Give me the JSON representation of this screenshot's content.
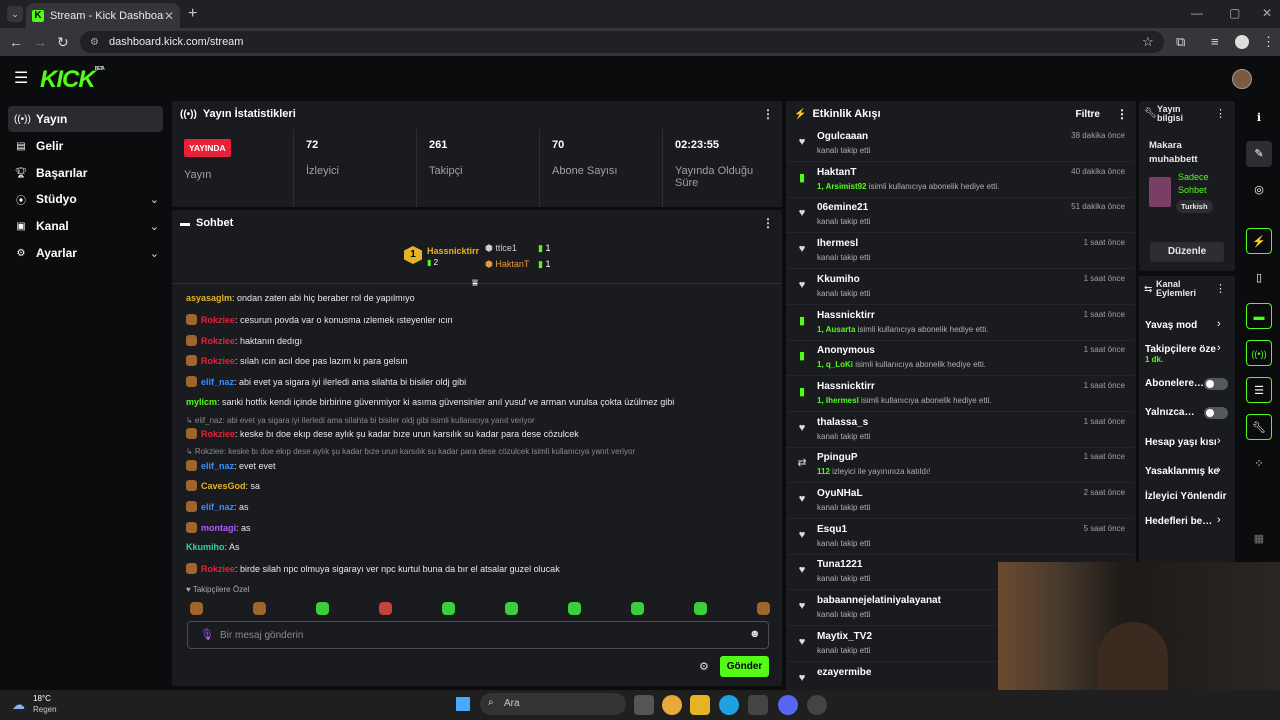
{
  "browser": {
    "tab_title": "Stream - Kick Dashboard",
    "url": "dashboard.kick.com/stream"
  },
  "brand": {
    "logo": "KICK",
    "logo_sup": "BETA",
    "accent": "#53fc18",
    "live_color": "#e8203a"
  },
  "sidebar": {
    "items": [
      {
        "label": "Yayın",
        "icon": "broadcast-icon",
        "active": true
      },
      {
        "label": "Gelir",
        "icon": "money-icon"
      },
      {
        "label": "Başarılar",
        "icon": "trophy-icon"
      },
      {
        "label": "Stüdyo",
        "icon": "studio-icon",
        "expand": true
      },
      {
        "label": "Kanal",
        "icon": "channel-icon",
        "expand": true
      },
      {
        "label": "Ayarlar",
        "icon": "gear-icon",
        "expand": true
      }
    ]
  },
  "stats": {
    "title": "Yayın İstatistikleri",
    "live_badge": "YAYINDA",
    "live_label": "Yayın",
    "items": [
      {
        "value": "72",
        "label": "İzleyici"
      },
      {
        "value": "261",
        "label": "Takipçi"
      },
      {
        "value": "70",
        "label": "Abone Sayısı"
      },
      {
        "value": "02:23:55",
        "label": "Yayında Olduğu Süre"
      }
    ]
  },
  "chat": {
    "title": "Sohbet",
    "top": {
      "rank": "1",
      "name": "Hassnicktirr",
      "count": "2",
      "second": {
        "name": "ttlce1",
        "count": "1"
      },
      "third": {
        "name": "HaktanT",
        "count": "1"
      }
    },
    "messages": [
      {
        "user": "asyasaglm",
        "color": "#e6b422",
        "text": ": ondan zaten abi hiç beraber rol de yapılmıyo",
        "badge": false
      },
      {
        "user": "Rokziee",
        "color": "#e8203a",
        "text": ": cesurun povda var o konusma ızlemek ısteyenler ıcın",
        "badge": true
      },
      {
        "user": "Rokziee",
        "color": "#e8203a",
        "text": ": haktanın dedıgı",
        "badge": true
      },
      {
        "user": "Rokziee",
        "color": "#e8203a",
        "text": ": sılah ıcın acıl doe pas lazım kı para gelsın",
        "badge": true
      },
      {
        "user": "elif_naz",
        "color": "#3b8dff",
        "text": ": abi evet ya sigara iyi ilerledi ama silahta bi bisiler oldj gibi",
        "badge": true
      },
      {
        "user": "mylicm",
        "color": "#53fc18",
        "text": ": sanki hotfix kendi içinde birbirine güvenmiyor ki asıma güvensinler anıl yusuf ve arman vurulsa çokta üzülmez gibi",
        "badge": false
      },
      {
        "reply": "↳ elif_naz: abi evet ya sigara iyi ilerledi ama silahta bi bisiler oldj gibi isimli kullanıcıya yanıt veriyor"
      },
      {
        "user": "Rokziee",
        "color": "#e8203a",
        "text": ": keske bı doe ekıp dese aylık şu kadar bıze urun karsılık su kadar para dese cözulcek",
        "badge": true
      },
      {
        "reply": "↳ Rokziee: keske bı doe ekıp dese aylık şu kadar bıze urun karsılık su kadar para dese cözulcek isimli kullanıcıya yanıt veriyor"
      },
      {
        "user": "elif_naz",
        "color": "#3b8dff",
        "text": ": evet evet",
        "badge": true
      },
      {
        "user": "CavesGod",
        "color": "#e6b422",
        "text": ": sa",
        "badge": true
      },
      {
        "user": "elif_naz",
        "color": "#3b8dff",
        "text": ": as",
        "badge": true
      },
      {
        "user": "montagi",
        "color": "#b05cff",
        "text": ": as",
        "badge": true
      },
      {
        "user": "Kkumiho",
        "color": "#2fd3a4",
        "text": ": As",
        "badge": false
      },
      {
        "user": "Rokziee",
        "color": "#e8203a",
        "text": ": birde silah npc olmuya sigarayı ver npc kurtul buna da bır el atsalar guzel olucak",
        "badge": true
      }
    ],
    "followers_only": "Takipçilere Özel",
    "input_placeholder": "Bir mesaj gönderin",
    "send_label": "Gönder"
  },
  "events": {
    "title": "Etkinlik Akışı",
    "filter_label": "Filtre",
    "items": [
      {
        "name": "Ogulcaaan",
        "desc": "kanalı takip etti",
        "time": "38 dakika önce",
        "type": "follow"
      },
      {
        "name": "HaktanT",
        "hl": "1, Arsimist92",
        "desc": " isimli kullanıcıya abonelik hediye etti.",
        "time": "40 dakika önce",
        "type": "gift"
      },
      {
        "name": "06emine21",
        "desc": "kanalı takip etti",
        "time": "51 dakika önce",
        "type": "follow"
      },
      {
        "name": "Ihermesl",
        "desc": "kanalı takip etti",
        "time": "1 saat önce",
        "type": "follow"
      },
      {
        "name": "Kkumiho",
        "desc": "kanalı takip etti",
        "time": "1 saat önce",
        "type": "follow"
      },
      {
        "name": "Hassnicktirr",
        "hl": "1, Ausarta",
        "desc": " isimli kullanıcıya abonelik hediye etti.",
        "time": "1 saat önce",
        "type": "gift"
      },
      {
        "name": "Anonymous",
        "hl": "1, q_LoKi",
        "desc": " isimli kullanıcıya abonelik hediye etti.",
        "time": "1 saat önce",
        "type": "gift"
      },
      {
        "name": "Hassnicktirr",
        "hl": "1, Ihermesl",
        "desc": " isimli kullanıcıya abonelik hediye etti.",
        "time": "1 saat önce",
        "type": "gift"
      },
      {
        "name": "thalassa_s",
        "desc": "kanalı takip etti",
        "time": "1 saat önce",
        "type": "follow"
      },
      {
        "name": "PpinguP",
        "hl": "112",
        "desc": " izleyici ile yayınınıza katıldı!",
        "time": "1 saat önce",
        "type": "host"
      },
      {
        "name": "OyuNHaL",
        "desc": "kanalı takip etti",
        "time": "2 saat önce",
        "type": "follow"
      },
      {
        "name": "Esqu1",
        "desc": "kanalı takip etti",
        "time": "5 saat önce",
        "type": "follow"
      },
      {
        "name": "Tuna1221",
        "desc": "kanalı takip etti",
        "time": "",
        "type": "follow"
      },
      {
        "name": "babaannejelatiniyalayanat",
        "desc": "kanalı takip etti",
        "time": "",
        "type": "follow"
      },
      {
        "name": "Maytix_TV2",
        "desc": "kanalı takip etti",
        "time": "",
        "type": "follow"
      },
      {
        "name": "ezayermibe",
        "desc": "",
        "time": "",
        "type": "follow"
      }
    ]
  },
  "stream_info": {
    "title": "Yayın bilgisi",
    "stream_title": "Makara muhabbett",
    "category": "Sadece Sohbet",
    "tag": "Turkish",
    "edit_label": "Düzenle"
  },
  "channel_actions": {
    "title": "Kanal Eylemleri",
    "items": [
      {
        "label": "Yavaş mod",
        "kind": "chevron"
      },
      {
        "label": "Takipçilere öze",
        "sub": "1 dk.",
        "kind": "chevron"
      },
      {
        "label": "Abonelere…",
        "kind": "toggle"
      },
      {
        "label": "Yalnızca…",
        "kind": "toggle"
      },
      {
        "label": "Hesap yaşı kısı",
        "kind": "chevron"
      },
      {
        "label": "Yasaklanmış ke",
        "kind": "chevron"
      },
      {
        "label": "İzleyici Yönlendir",
        "kind": "none"
      },
      {
        "label": "Hedefleri be…",
        "kind": "chevron"
      }
    ]
  },
  "taskbar": {
    "temp": "18°C",
    "weather": "Regen",
    "search": "Ara"
  }
}
